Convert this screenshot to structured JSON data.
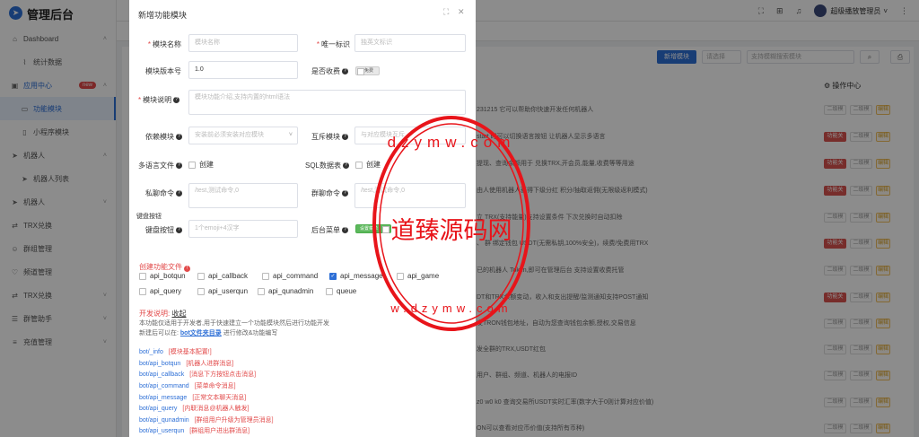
{
  "app": {
    "title": "管理后台"
  },
  "sidebar": {
    "items": [
      {
        "label": "Dashboard",
        "icon": "home-icon"
      },
      {
        "label": "统计数据",
        "icon": "chart-line-icon"
      },
      {
        "label": "应用中心",
        "icon": "apps-icon",
        "badge": "new"
      },
      {
        "label": "功能模块",
        "icon": "module-icon"
      },
      {
        "label": "小程序模块",
        "icon": "mini-program-icon"
      },
      {
        "label": "机器人",
        "icon": "send-icon"
      },
      {
        "label": "机器人列表",
        "icon": "send-icon"
      },
      {
        "label": "机器人",
        "icon": "send-icon"
      },
      {
        "label": "TRX兑换",
        "icon": "exchange-icon"
      },
      {
        "label": "群组管理",
        "icon": "group-icon"
      },
      {
        "label": "频道管理",
        "icon": "heart-icon"
      },
      {
        "label": "TRX兑换",
        "icon": "exchange-icon"
      },
      {
        "label": "群管助手",
        "icon": "assistant-icon"
      },
      {
        "label": "充值管理",
        "icon": "recharge-icon"
      }
    ]
  },
  "header": {
    "user": "超级播放管理员"
  },
  "background": {
    "new_button": "新增模块",
    "select_placeholder": "请选择",
    "search_placeholder": "支持模糊搜索模块",
    "ops_header": "操作中心",
    "op_red": "功能关",
    "op_white": "二级模",
    "op_yellow": "编辑",
    "rows": [
      {
        "text": "231215 它可以帮助你快速开发任何机器人"
      },
      {
        "text": "start 时可以切换语言按钮 让机器人显示多语言"
      },
      {
        "text": "提现、查询余额用于 兑换TRX,开会员,能量,收费等等用途"
      },
      {
        "text": "由人使用机器人获得下级分红 积分/抽取返佣(无限级返利模式)"
      },
      {
        "text": "立 TRX(支持能量)支持设置条件 下次兑换时自动扣除"
      },
      {
        "text": "、 群 绑定钱包 USDT(无需私钥,100%安全)，续费/免费用TRX"
      },
      {
        "text": "已的机器人 Token,即可在管理后台 支持设置收费托管"
      },
      {
        "text": "DT和TRX余额变动，收入和支出提醒/监测通知支持POST通知"
      },
      {
        "text": "发TRON钱包地址，自动为您查询钱包余额,授权,交易信息"
      },
      {
        "text": "发全群的TRX,USDT红包"
      },
      {
        "text": "用户、群组、频道、机器人的电报ID"
      },
      {
        "text": "z0 w0 k0 查询交易所USDT实时汇率(数字大于0则计算对应价值)"
      },
      {
        "text": "ON可以查看对应币价值(支持所有币种)"
      }
    ]
  },
  "modal": {
    "title": "新增功能模块",
    "fields": {
      "module_name": {
        "label": "模块名称",
        "placeholder": "模块名称"
      },
      "unique_id": {
        "label": "唯一标识",
        "placeholder": "独英文标识"
      },
      "version": {
        "label": "模块版本号",
        "value": "1.0"
      },
      "charge": {
        "label": "是否收费",
        "toggle": "免费"
      },
      "description": {
        "label": "模块说明",
        "placeholder": "模块功能介绍,支持内置的html语法"
      },
      "depends": {
        "label": "依赖模块",
        "placeholder": "安装前必须安装对应模块"
      },
      "conflict": {
        "label": "互斥模块",
        "placeholder": "与对应模块互斥"
      },
      "multilang": {
        "label": "多语言文件",
        "checkbox": "创建"
      },
      "sql": {
        "label": "SQL数据表",
        "checkbox": "创建"
      },
      "private_cmd": {
        "label": "私聊命令",
        "placeholder": "/test,测试命令,0"
      },
      "group_cmd": {
        "label": "群聊命令",
        "placeholder": "/test,测试命令,0"
      },
      "keyboard_hint": "键盘按钮",
      "keyboard": {
        "label": "键盘按钮",
        "placeholder": "1个emoji+4汉字"
      },
      "backend_menu": {
        "label": "后台菜单",
        "toggle": "设置菜单"
      }
    },
    "create_files_title": "创建功能文件",
    "files": [
      {
        "name": "api_botqun",
        "checked": false
      },
      {
        "name": "api_callback",
        "checked": false
      },
      {
        "name": "api_command",
        "checked": false
      },
      {
        "name": "api_message",
        "checked": true
      },
      {
        "name": "api_game",
        "checked": false
      },
      {
        "name": "api_query",
        "checked": false
      },
      {
        "name": "api_userqun",
        "checked": false
      },
      {
        "name": "api_qunadmin",
        "checked": false
      },
      {
        "name": "queue",
        "checked": false
      }
    ],
    "dev_notes_title": "开发说明:",
    "dev_notes_toggle": "收起",
    "dev_note_1": "本功能仅适用于开发者,用于快速建立一个功能模块然后进行功能开发",
    "dev_note_2_prefix": "新建后可以在:",
    "dev_note_2_link": "bot文件夹目录",
    "dev_note_2_suffix": "进行修改&功能编写",
    "file_descs": [
      {
        "path": "bot/_info",
        "desc": "[模块基本配置!]"
      },
      {
        "path": "bot/api_botqun",
        "desc": "[机器人进群消息]"
      },
      {
        "path": "bot/api_callback",
        "desc": "[消息下方按钮点击消息]"
      },
      {
        "path": "bot/api_command",
        "desc": "[菜单命令消息]"
      },
      {
        "path": "bot/api_message",
        "desc": "[正常文本聊天消息]"
      },
      {
        "path": "bot/api_query",
        "desc": "[内联消息@机器人触发]"
      },
      {
        "path": "bot/api_qunadmin",
        "desc": "[群组用户升级为管理员消息]"
      },
      {
        "path": "bot/api_userqun",
        "desc": "[群组用户进出群消息]"
      }
    ]
  },
  "watermark": {
    "text": "道臻源码网",
    "ring_top": "dzymw.com",
    "ring_bottom": "w.dzymw.com",
    "color": "#e8141a"
  }
}
